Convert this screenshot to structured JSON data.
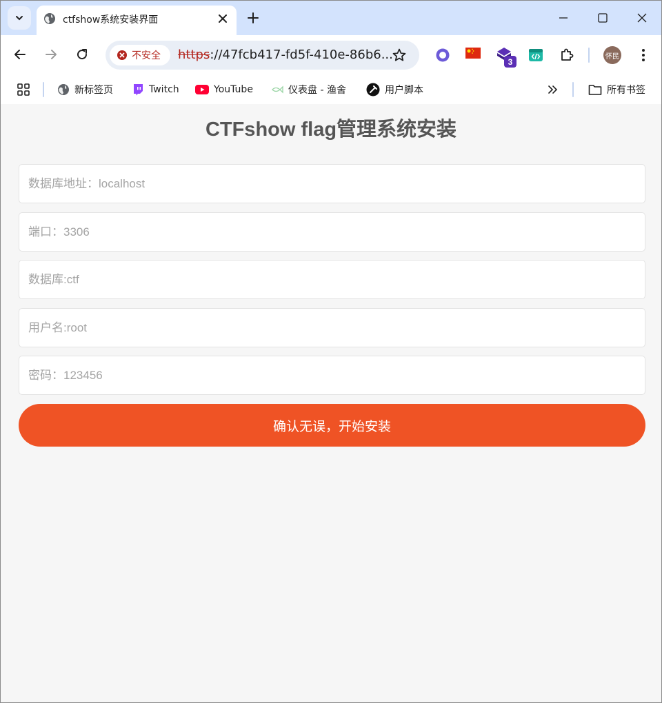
{
  "browser": {
    "tab_title": "ctfshow系统安装界面",
    "security_label": "不安全",
    "url_scheme": "https",
    "url_rest": "://47fcb417-fd5f-410e-86b6...",
    "ext_badge": "3",
    "avatar_text": "怀民"
  },
  "bookmarks": [
    {
      "label": "新标签页"
    },
    {
      "label": "Twitch"
    },
    {
      "label": "YouTube"
    },
    {
      "label": "仪表盘 - 渔舍"
    },
    {
      "label": "用户脚本"
    }
  ],
  "all_bookmarks_label": "所有书签",
  "page": {
    "title": "CTFshow flag管理系统安装",
    "fields": [
      {
        "placeholder": "数据库地址：localhost"
      },
      {
        "placeholder": "端口：3306"
      },
      {
        "placeholder": "数据库:ctf"
      },
      {
        "placeholder": "用户名:root"
      },
      {
        "placeholder": "密码：123456"
      }
    ],
    "submit_label": "确认无误，开始安装"
  },
  "colors": {
    "accent": "#ef5325",
    "tabstrip": "#d3e3fd",
    "page_bg": "#f6f6f6"
  }
}
